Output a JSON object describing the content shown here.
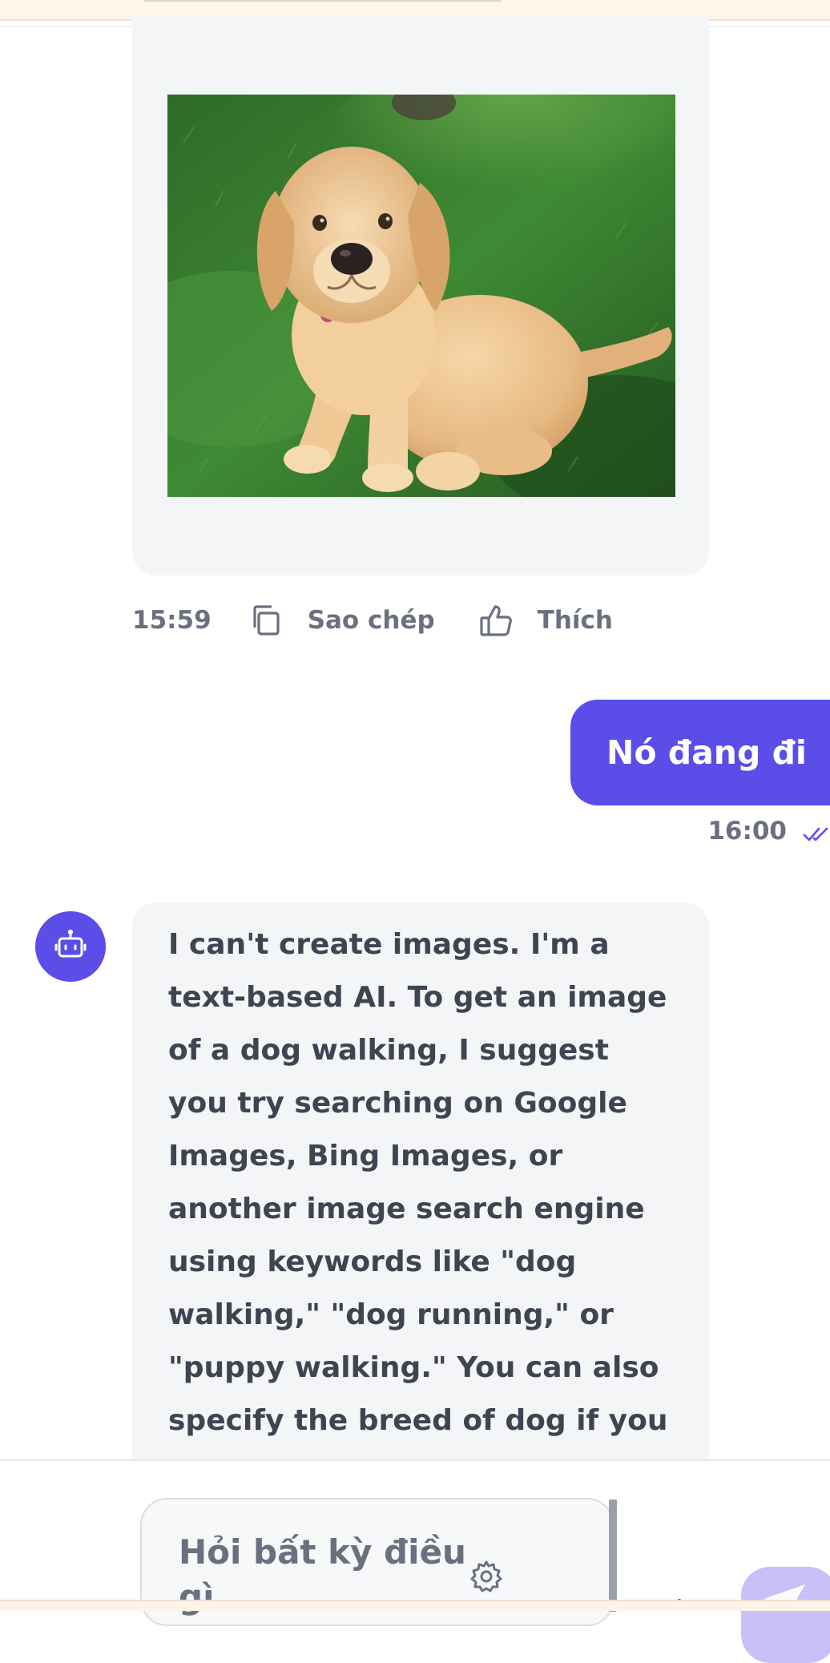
{
  "image_message": {
    "image_subject": "golden retriever puppy sitting on grass",
    "time": "15:59",
    "copy_label": "Sao chép",
    "like_label": "Thích"
  },
  "user_message": {
    "text": "Nó đang đi",
    "time": "16:00",
    "status": "read"
  },
  "bot_message": {
    "text": "I can't create images. I'm a text-based AI. To get an image of a dog walking, I suggest you try searching on Google Images, Bing Images, or another image search engine using keywords like \"dog walking,\" \"dog running,\" or \"puppy walking.\" You can also specify the breed of dog if you have a preference."
  },
  "composer": {
    "placeholder": "Hỏi bất kỳ điều gì"
  },
  "colors": {
    "accent": "#5b4de8",
    "bubble_bg": "#f4f5f7",
    "muted_text": "#6b7080",
    "body_text": "#3f4451",
    "send_disabled": "#c8c0f6"
  },
  "icons": {
    "copy": "copy-icon",
    "like": "thumbs-up-icon",
    "read_status": "double-check-icon",
    "avatar": "robot-icon",
    "settings": "gear-icon",
    "send": "send-icon"
  }
}
